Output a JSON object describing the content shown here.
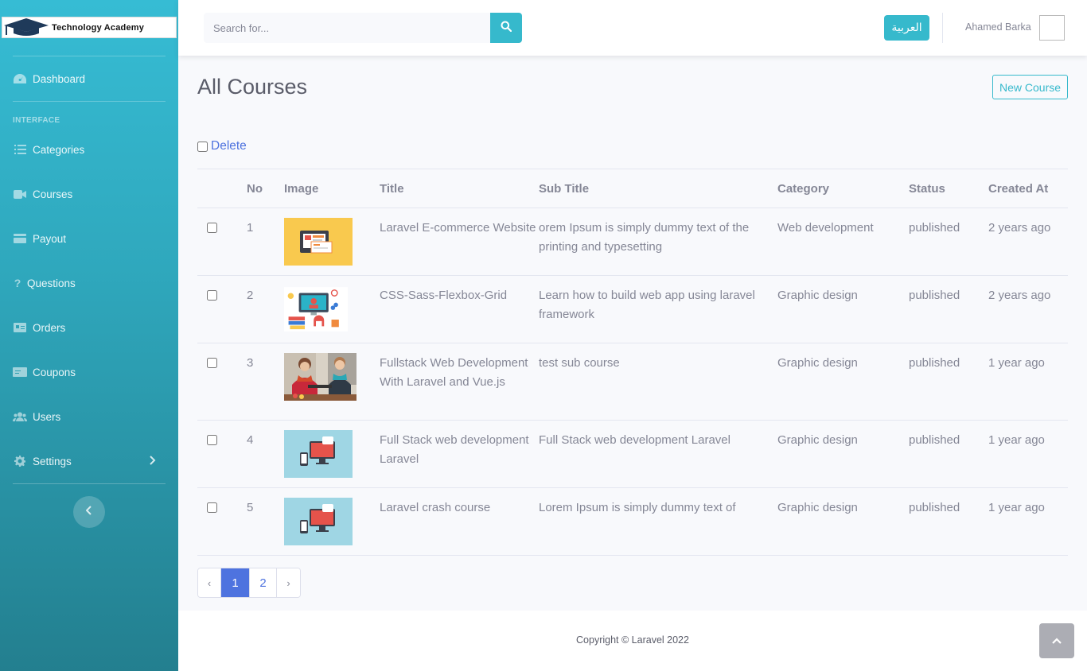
{
  "brand": {
    "name": "Technology Academy"
  },
  "sidebar": {
    "dashboard": "Dashboard",
    "heading": "INTERFACE",
    "items": [
      {
        "label": "Categories",
        "icon": "list-icon"
      },
      {
        "label": "Courses",
        "icon": "video-icon"
      },
      {
        "label": "Payout",
        "icon": "credit-card-icon"
      },
      {
        "label": "Questions",
        "icon": "question-icon"
      },
      {
        "label": "Orders",
        "icon": "id-card-icon"
      },
      {
        "label": "Coupons",
        "icon": "ticket-icon"
      },
      {
        "label": "Users",
        "icon": "users-icon"
      },
      {
        "label": "Settings",
        "icon": "gear-icon"
      }
    ]
  },
  "topbar": {
    "search_placeholder": "Search for...",
    "language_button": "العربية",
    "user_name": "Ahamed Barka"
  },
  "page": {
    "title": "All Courses",
    "new_course_button": "New Course",
    "bulk_delete": "Delete"
  },
  "table": {
    "headers": [
      "No",
      "Image",
      "Title",
      "Sub Title",
      "Category",
      "Status",
      "Created At"
    ],
    "rows": [
      {
        "no": "1",
        "title": "Laravel E-commerce Website",
        "sub_title": "orem Ipsum is simply dummy text of the printing and typesetting",
        "category": "Web development",
        "status": "published",
        "created_at": "2 years ago"
      },
      {
        "no": "2",
        "title": "CSS-Sass-Flexbox-Grid",
        "sub_title": "Learn how to build web app using laravel framework",
        "category": "Graphic design",
        "status": "published",
        "created_at": "2 years ago"
      },
      {
        "no": "3",
        "title": "Fullstack Web Development With Laravel and Vue.js",
        "sub_title": "test sub course",
        "category": "Graphic design",
        "status": "published",
        "created_at": "1 year ago"
      },
      {
        "no": "4",
        "title": "Full Stack web development Laravel",
        "sub_title": "Full Stack web development Laravel",
        "category": "Graphic design",
        "status": "published",
        "created_at": "1 year ago"
      },
      {
        "no": "5",
        "title": "Laravel crash course",
        "sub_title": "Lorem Ipsum is simply dummy text of",
        "category": "Graphic design",
        "status": "published",
        "created_at": "1 year ago"
      }
    ]
  },
  "pagination": {
    "prev": "‹",
    "pages": [
      "1",
      "2"
    ],
    "next": "›",
    "current": "1"
  },
  "footer": {
    "copyright": "Copyright © Laravel 2022"
  },
  "colors": {
    "sidebar_top": "#36bcd4",
    "sidebar_bottom": "#237f8f",
    "accent": "#36b9cc",
    "primary": "#4e73df"
  }
}
